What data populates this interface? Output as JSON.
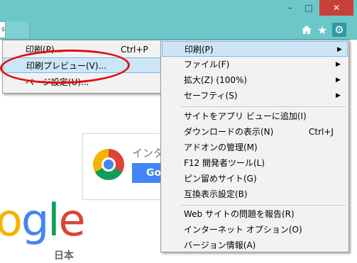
{
  "toolbar": {
    "address_fragment": "s",
    "window_buttons": {
      "minimize": "–",
      "maximize": "□",
      "close": "✕"
    },
    "icons": {
      "home": "home-icon",
      "favorites": "star-icon",
      "tools": "gear-icon"
    }
  },
  "print_menu": {
    "items": [
      {
        "label": "印刷(P)...",
        "shortcut": "Ctrl+P"
      },
      {
        "label": "印刷プレビュー(V)...",
        "shortcut": ""
      },
      {
        "label": "ページ設定(U)...",
        "shortcut": ""
      }
    ]
  },
  "tools_menu": {
    "items": [
      {
        "label": "印刷(P)",
        "shortcut": "",
        "submenu": true
      },
      {
        "label": "ファイル(F)",
        "shortcut": "",
        "submenu": true
      },
      {
        "label": "拡大(Z) (100%)",
        "shortcut": "",
        "submenu": true
      },
      {
        "label": "セーフティ(S)",
        "shortcut": "",
        "submenu": true
      },
      {
        "label": "サイトをアプリ ビューに追加(I)",
        "shortcut": ""
      },
      {
        "label": "ダウンロードの表示(N)",
        "shortcut": "Ctrl+J"
      },
      {
        "label": "アドオンの管理(M)",
        "shortcut": ""
      },
      {
        "label": "F12 開発者ツール(L)",
        "shortcut": ""
      },
      {
        "label": "ピン留めサイト(G)",
        "shortcut": ""
      },
      {
        "label": "互換表示設定(B)",
        "shortcut": ""
      },
      {
        "label": "Web サイトの問題を報告(R)",
        "shortcut": ""
      },
      {
        "label": "インターネット オプション(O)",
        "shortcut": ""
      },
      {
        "label": "バージョン情報(A)",
        "shortcut": ""
      }
    ]
  },
  "page": {
    "card_text": "インタ",
    "card_button": "Go",
    "logo_letters": [
      "o",
      "g",
      "l",
      "e"
    ],
    "logo_sub": "日本"
  },
  "colors": {
    "titlebar": "#6cc7c9",
    "highlight": "#cde6f7",
    "annotation": "#e01010",
    "google_blue": "#4285f4",
    "google_red": "#db4437",
    "google_yellow": "#f4b400",
    "google_green": "#0f9d58"
  }
}
